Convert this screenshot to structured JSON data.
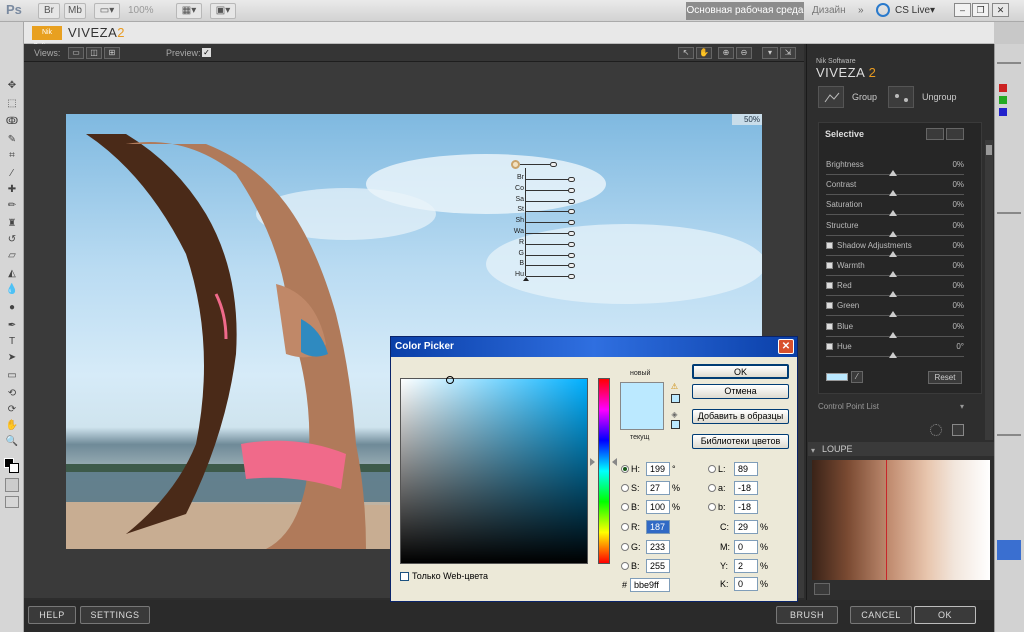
{
  "ps": {
    "logo": "Ps",
    "zoom": "100%",
    "workspace": "Основная рабочая среда",
    "design": "Дизайн",
    "cslive": "CS Live▾"
  },
  "doc": {
    "badge": "Nik Software",
    "title_main": "VIVEZA",
    "title_num": "2"
  },
  "viveza": {
    "views_label": "Views:",
    "preview_label": "Preview:",
    "zoom_badge": "50%",
    "nik_label": "Nik Software",
    "brand_main": "VIVEZA",
    "brand_num": "2",
    "group_label": "Group",
    "ungroup_label": "Ungroup",
    "selective_label": "Selective",
    "sliders": [
      {
        "name": "Brightness",
        "value": "0%",
        "checkbox": false
      },
      {
        "name": "Contrast",
        "value": "0%",
        "checkbox": false
      },
      {
        "name": "Saturation",
        "value": "0%",
        "checkbox": false
      },
      {
        "name": "Structure",
        "value": "0%",
        "checkbox": false
      },
      {
        "name": "Shadow Adjustments",
        "value": "0%",
        "checkbox": true
      },
      {
        "name": "Warmth",
        "value": "0%",
        "checkbox": true
      },
      {
        "name": "Red",
        "value": "0%",
        "checkbox": true
      },
      {
        "name": "Green",
        "value": "0%",
        "checkbox": true
      },
      {
        "name": "Blue",
        "value": "0%",
        "checkbox": true
      },
      {
        "name": "Hue",
        "value": "0°",
        "checkbox": true
      }
    ],
    "reset_label": "Reset",
    "swatch_color": "#bbe9ff",
    "control_point_list": "Control Point List",
    "loupe_label": "LOUPE",
    "control_point_labels": [
      "Br",
      "Co",
      "Sa",
      "St",
      "Sh",
      "Wa",
      "R",
      "G",
      "B",
      "Hu"
    ],
    "buttons": {
      "help": "HELP",
      "settings": "SETTINGS",
      "brush": "BRUSH",
      "cancel": "CANCEL",
      "ok": "OK"
    }
  },
  "color_picker": {
    "title": "Color Picker",
    "close": "✕",
    "new_label": "новый",
    "current_label": "текущ",
    "new_color": "#bbe9ff",
    "current_color": "#bbe9ff",
    "buttons": {
      "ok": "OK",
      "cancel": "Отмена",
      "add_swatches": "Добавить в образцы",
      "libraries": "Библиотеки цветов"
    },
    "hsb": [
      {
        "label": "H:",
        "value": "199",
        "unit": "°",
        "selected": true
      },
      {
        "label": "S:",
        "value": "27",
        "unit": "%",
        "selected": false
      },
      {
        "label": "B:",
        "value": "100",
        "unit": "%",
        "selected": false
      }
    ],
    "rgb": [
      {
        "label": "R:",
        "value": "187",
        "highlighted": true
      },
      {
        "label": "G:",
        "value": "233",
        "highlighted": false
      },
      {
        "label": "B:",
        "value": "255",
        "highlighted": false
      }
    ],
    "lab": [
      {
        "label": "L:",
        "value": "89"
      },
      {
        "label": "a:",
        "value": "-18"
      },
      {
        "label": "b:",
        "value": "-18"
      }
    ],
    "cmyk": [
      {
        "label": "C:",
        "value": "29",
        "unit": "%"
      },
      {
        "label": "M:",
        "value": "0",
        "unit": "%"
      },
      {
        "label": "Y:",
        "value": "2",
        "unit": "%"
      },
      {
        "label": "K:",
        "value": "0",
        "unit": "%"
      }
    ],
    "hex_label": "#",
    "hex": "bbe9ff",
    "web_only": "Только Web-цвета"
  }
}
